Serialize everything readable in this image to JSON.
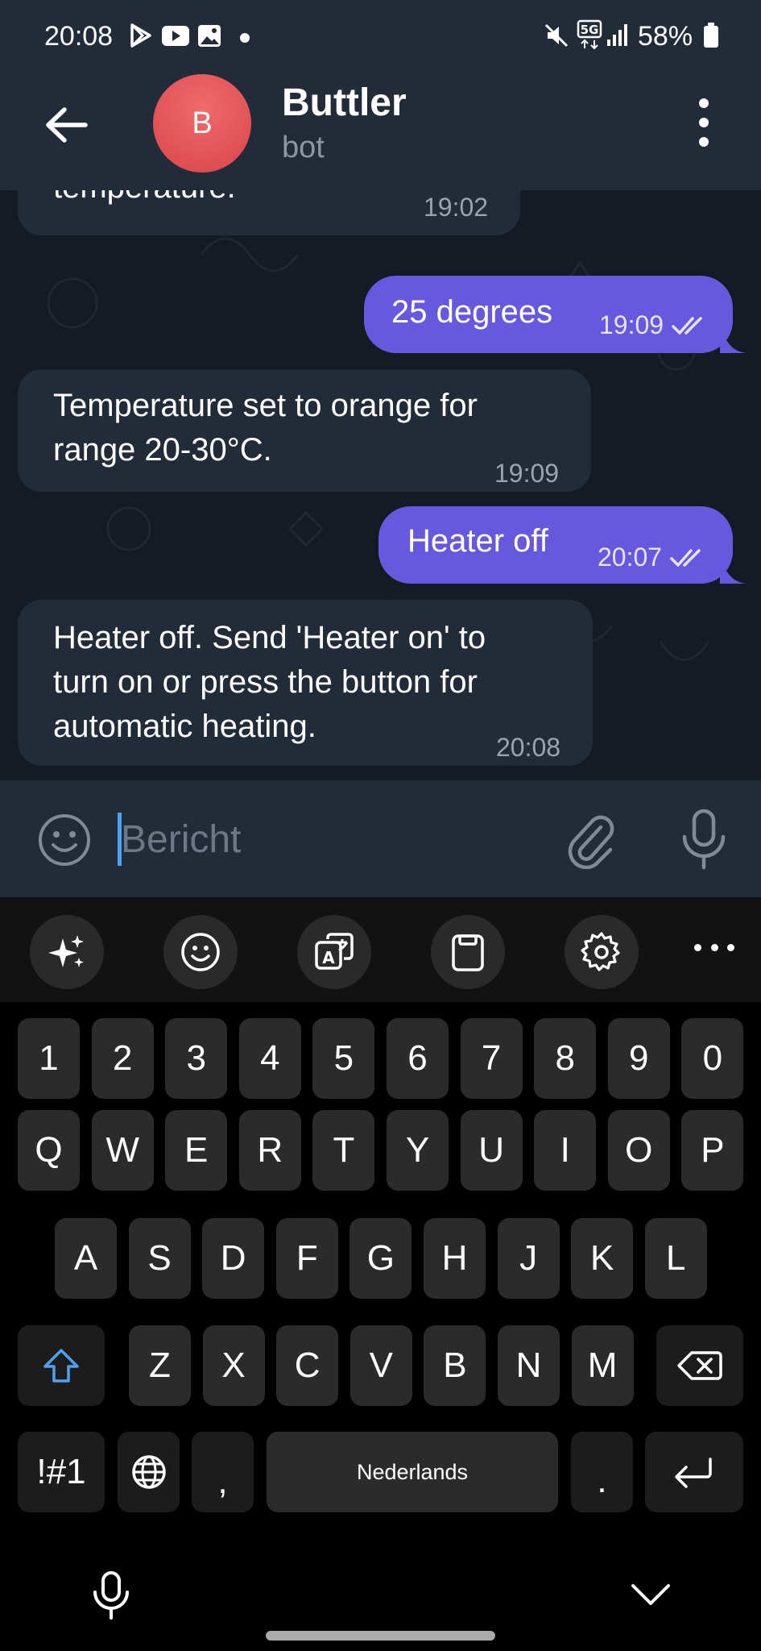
{
  "status_bar": {
    "time": "20:08",
    "network": "5G",
    "battery": "58%"
  },
  "chat": {
    "name": "Buttler",
    "subtitle": "bot",
    "avatar_letter": "B",
    "avatar_color": "#e0484e"
  },
  "messages": [
    {
      "direction": "incoming",
      "text": "temperature.",
      "time": "19:02"
    },
    {
      "direction": "outgoing",
      "text": "25 degrees",
      "time": "19:09",
      "read": true
    },
    {
      "direction": "incoming",
      "text": "Temperature set to orange for\nrange 20-30°C.",
      "time": "19:09"
    },
    {
      "direction": "outgoing",
      "text": "Heater off",
      "time": "20:07",
      "read": true
    },
    {
      "direction": "incoming",
      "text": "Heater off. Send 'Heater on' to\nturn on or press the button for\nautomatic heating.",
      "time": "20:08"
    }
  ],
  "composer": {
    "placeholder": "Bericht",
    "value": ""
  },
  "keyboard": {
    "toolbar_icons": [
      "sparkle-ai-icon",
      "emoji-icon",
      "translate-icon",
      "clipboard-icon",
      "settings-icon",
      "more-icon"
    ],
    "row_numbers": [
      "1",
      "2",
      "3",
      "4",
      "5",
      "6",
      "7",
      "8",
      "9",
      "0"
    ],
    "row_top": [
      "Q",
      "W",
      "E",
      "R",
      "T",
      "Y",
      "U",
      "I",
      "O",
      "P"
    ],
    "row_middle": [
      "A",
      "S",
      "D",
      "F",
      "G",
      "H",
      "J",
      "K",
      "L"
    ],
    "row_bottom": [
      "Z",
      "X",
      "C",
      "V",
      "B",
      "N",
      "M"
    ],
    "symbols_label": "!#1",
    "comma": ",",
    "space_label": "Nederlands",
    "period": "."
  },
  "colors": {
    "header_bg": "#222c39",
    "chat_bg": "#141b24",
    "incoming_bubble": "#222c39",
    "outgoing_bubble": "#6759dd",
    "accent": "#4ea0f0"
  }
}
